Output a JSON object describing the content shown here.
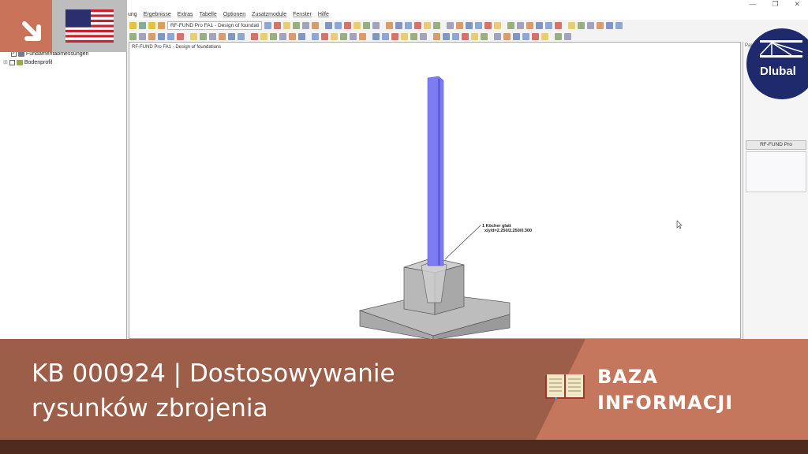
{
  "window": {
    "controls": [
      "—",
      "❐",
      "✕"
    ]
  },
  "menu": [
    "ung",
    "Ergebnisse",
    "Extras",
    "Tabelle",
    "Optionen",
    "Zusatzmodule",
    "Fenster",
    "Hilfe"
  ],
  "toolbar": {
    "case_select": "RF-FUND Pro FA1 - Design of foundati"
  },
  "tree": {
    "items": [
      {
        "label": "Fundamentabmessungen",
        "checked": true
      },
      {
        "label": "Bodenprofil",
        "checked": false
      }
    ]
  },
  "viewport": {
    "title": "RF-FUND Pro FA1 - Design of foundations",
    "annotation_line1": "1 Köcher glatt",
    "annotation_line2": "x/y/d=2.250/2.250/0.300"
  },
  "right_panel": {
    "header": "Par",
    "module_button": "RF-FUND Pro"
  },
  "logo": {
    "text": "Dlubal"
  },
  "banner": {
    "title_line1": "KB 000924 | Dostosowywanie",
    "title_line2": "rysunków zbrojenia",
    "category_line1": "BAZA",
    "category_line2": "INFORMACJI"
  },
  "colors": {
    "accent": "#c8735a",
    "banner_dark": "#9c5e48",
    "banner_light": "#c4775c",
    "footer": "#4e2a1f",
    "logo": "#1e2a6b",
    "column": "#7d7cf0"
  }
}
